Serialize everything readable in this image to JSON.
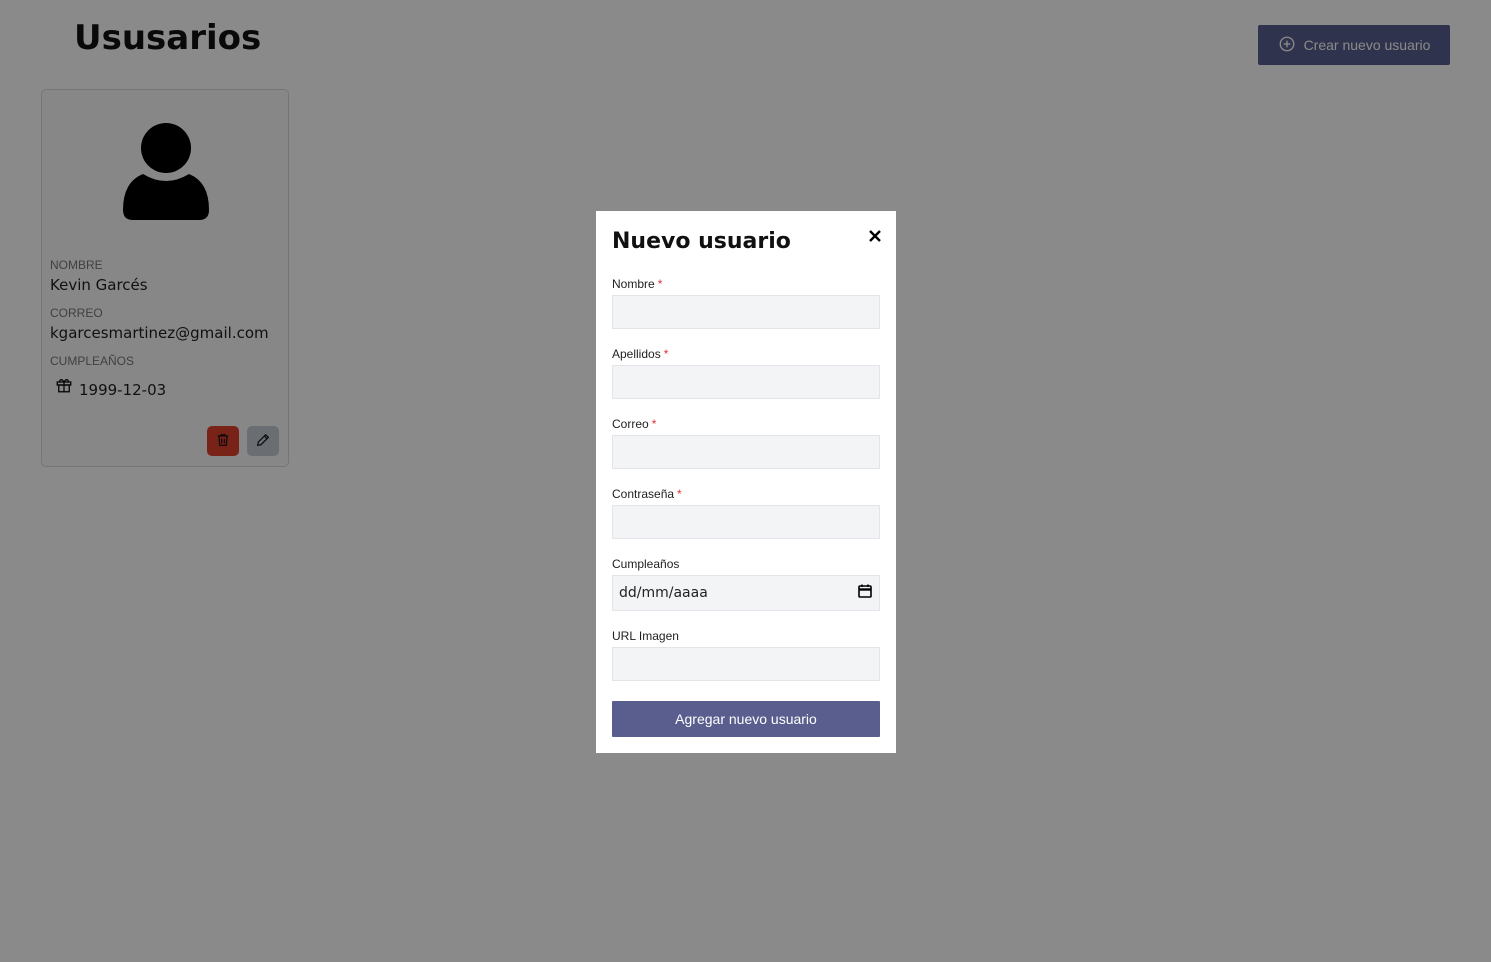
{
  "page": {
    "title": "Ususarios"
  },
  "toolbar": {
    "create_label": "Crear nuevo usuario",
    "create_icon": "plus-circle-icon"
  },
  "user_card": {
    "avatar_icon": "user-icon",
    "name_label": "NOMBRE",
    "name_value": "Kevin Garcés",
    "email_label": "CORREO",
    "email_value": "kgarcesmartinez@gmail.com",
    "birthday_label": "CUMPLEAÑOS",
    "birthday_icon": "gift-icon",
    "birthday_value": "1999-12-03",
    "delete_icon": "trash-icon",
    "edit_icon": "pencil-icon",
    "delete_color": "#de3f2d",
    "edit_color": "#c5cad2"
  },
  "modal": {
    "title": "Nuevo usuario",
    "close_icon": "close-icon",
    "fields": [
      {
        "label": "Nombre",
        "required": "*",
        "value": ""
      },
      {
        "label": "Apellidos",
        "required": "*",
        "value": ""
      },
      {
        "label": "Correo",
        "required": "*",
        "value": ""
      },
      {
        "label": "Contraseña",
        "required": "*",
        "value": ""
      },
      {
        "label": "Cumpleaños",
        "placeholder": "dd/mm/aaaa",
        "icon": "calendar-icon"
      },
      {
        "label": "URL Imagen",
        "value": ""
      }
    ],
    "submit_label": "Agregar nuevo usuario"
  },
  "colors": {
    "accent": "#595e8e",
    "danger": "#de3f2d",
    "overlay": "rgba(0,0,0,0.46)"
  }
}
